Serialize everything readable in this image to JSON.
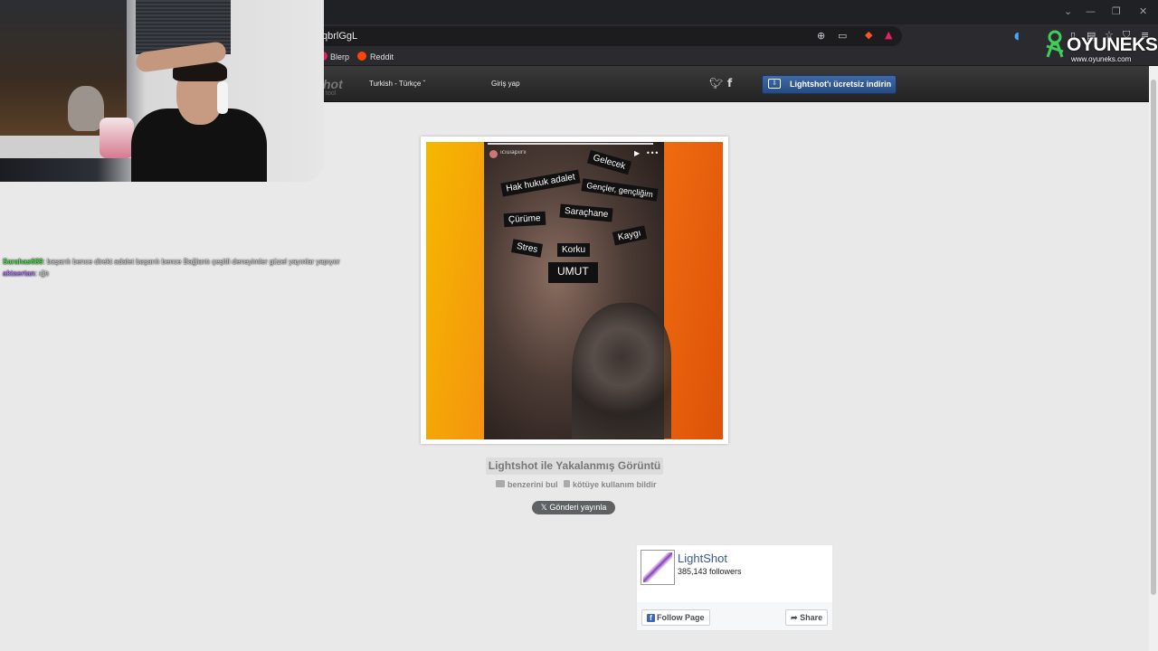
{
  "browser": {
    "url": "qbrlGgL",
    "bookmarks": [
      {
        "label": "Blerp",
        "color": "#e0245e"
      },
      {
        "label": "Reddit",
        "color": "#ff4500"
      }
    ],
    "window_controls": {
      "chevron": "⌄",
      "minimize": "—",
      "restore": "❐",
      "close": "✕"
    }
  },
  "lightshot_header": {
    "logo_text": "hot",
    "logo_sub": "tool",
    "language": "Turkish - Türkçe",
    "login": "Giriş yap",
    "download_button": "Lightshot'ı ücretsiz indirin",
    "social_icons": [
      "twitter-icon",
      "facebook-icon"
    ]
  },
  "screenshot": {
    "tags": [
      "Gelecek",
      "Hak hukuk adalet",
      "Gençler, gençliğim",
      "Çürüme",
      "Saraçhane",
      "Kaygı",
      "Stres",
      "Korku",
      "UMUT"
    ],
    "video_account": "ıcıuıapıırıı"
  },
  "page": {
    "caption": "Lightshot ile Yakalanmış Görüntü",
    "find_similar": "benzerini bul",
    "report_abuse": "kötüye kullanım bildir",
    "post_button": "Gönderi yayınla"
  },
  "facebook_widget": {
    "page_name": "LightShot",
    "followers": "385,143 followers",
    "follow_button": "Follow Page",
    "share_button": "Share"
  },
  "chat": [
    {
      "user": "Sarahas689",
      "user_color": "#55e655",
      "message": ": başarılı bence direkt adalet başarılı bence Bağlantı çeşitli deneyimler güzel yayınlar yapıyor"
    },
    {
      "user": "aktaertan",
      "user_color": "#b479ff",
      "message": ": ığtı"
    }
  ],
  "watermark": {
    "title": "OYUNEKS",
    "subtitle": "www.oyuneks.com"
  }
}
